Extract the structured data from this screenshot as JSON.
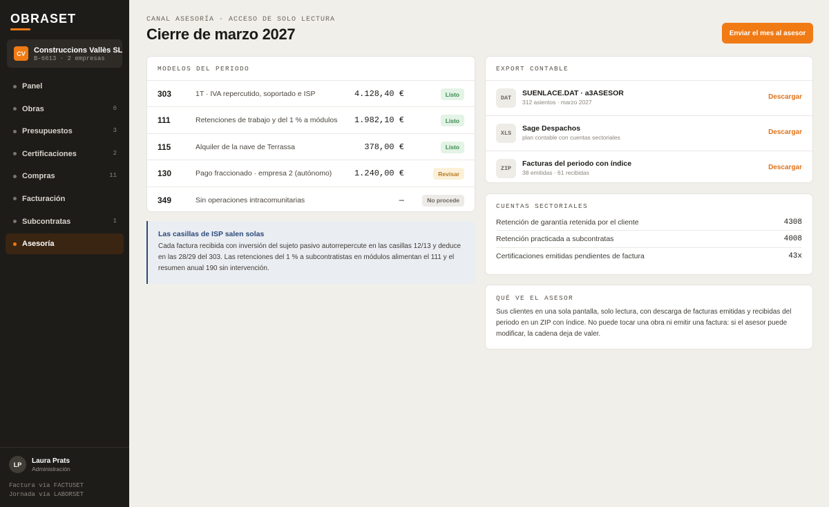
{
  "app": {
    "logo": "OBRASET"
  },
  "company": {
    "initials": "CV",
    "name": "Construccions Vallès SL",
    "sub": "B-6613 · 2 empresas"
  },
  "nav": [
    {
      "label": "Panel",
      "count": ""
    },
    {
      "label": "Obras",
      "count": "6"
    },
    {
      "label": "Presupuestos",
      "count": "3"
    },
    {
      "label": "Certificaciones",
      "count": "2"
    },
    {
      "label": "Compras",
      "count": "11"
    },
    {
      "label": "Facturación",
      "count": ""
    },
    {
      "label": "Subcontratas",
      "count": "1"
    },
    {
      "label": "Asesoría",
      "count": "",
      "active": true
    }
  ],
  "user": {
    "initials": "LP",
    "name": "Laura Prats",
    "role": "Administración"
  },
  "footer": {
    "line1": "Factura vía FACTUSET",
    "line2": "Jornada vía LABORSET"
  },
  "header": {
    "breadcrumb": "CANAL ASESORÍA · ACCESO DE SOLO LECTURA",
    "title": "Cierre de marzo 2027",
    "send_button": "Enviar el mes al asesor"
  },
  "models": {
    "title": "MODELOS DEL PERIODO",
    "rows": [
      {
        "code": "303",
        "desc": "1T · IVA repercutido, soportado e ISP",
        "amount": "4.128,40 €",
        "status": "Listo"
      },
      {
        "code": "111",
        "desc": "Retenciones de trabajo y del 1 % a módulos",
        "amount": "1.982,10 €",
        "status": "Listo"
      },
      {
        "code": "115",
        "desc": "Alquiler de la nave de Terrassa",
        "amount": "378,00 €",
        "status": "Listo"
      },
      {
        "code": "130",
        "desc": "Pago fraccionado · empresa 2 (autónomo)",
        "amount": "1.240,00 €",
        "status": "Revisar"
      },
      {
        "code": "349",
        "desc": "Sin operaciones intracomunitarias",
        "amount": "—",
        "status": "No procede"
      }
    ]
  },
  "note": {
    "title": "Las casillas de ISP salen solas",
    "text": "Cada factura recibida con inversión del sujeto pasivo autorrepercute en las casillas 12/13 y deduce en las 28/29 del 303. Las retenciones del 1 % a subcontratistas en módulos alimentan el 111 y el resumen anual 190 sin intervención."
  },
  "export": {
    "title": "EXPORT CONTABLE",
    "rows": [
      {
        "icon": "DAT",
        "name": "SUENLACE.DAT · a3ASESOR",
        "sub": "312 asientos · marzo 2027",
        "action": "Descargar"
      },
      {
        "icon": "XLS",
        "name": "Sage Despachos",
        "sub": "plan contable con cuentas sectoriales",
        "action": "Descargar"
      },
      {
        "icon": "ZIP",
        "name": "Facturas del periodo con índice",
        "sub": "38 emitidas · 61 recibidas",
        "action": "Descargar"
      }
    ]
  },
  "sectoriales": {
    "title": "CUENTAS SECTORIALES",
    "rows": [
      {
        "label": "Retención de garantía retenida por el cliente",
        "value": "4308"
      },
      {
        "label": "Retención practicada a subcontratas",
        "value": "4008"
      },
      {
        "label": "Certificaciones emitidas pendientes de factura",
        "value": "43x"
      }
    ]
  },
  "asesor": {
    "title": "QUÉ VE EL ASESOR",
    "text": "Sus clientes en una sola pantalla, solo lectura, con descarga de facturas emitidas y recibidas del periodo en un ZIP con índice. No puede tocar una obra ni emitir una factura: si el asesor puede modificar, la cadena deja de valer."
  },
  "colors": {
    "accent": "#f07a14",
    "sidebar": "#1e1c19",
    "ok": "#3a8a4e",
    "warn": "#b7791f",
    "link": "#e0741a"
  }
}
